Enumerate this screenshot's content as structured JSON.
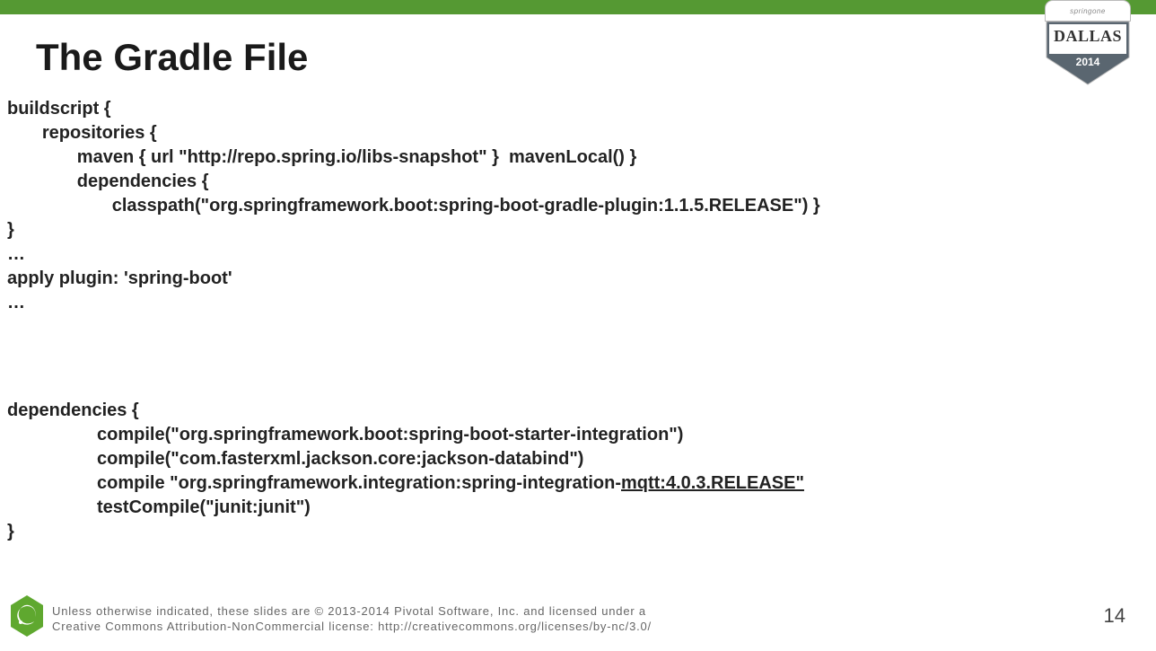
{
  "title": "The Gradle File",
  "badge": {
    "brand": "springone",
    "city": "DALLAS",
    "year": "2014"
  },
  "code_block_1": "buildscript {\n       repositories {\n              maven { url \"http://repo.spring.io/libs-snapshot\" }  mavenLocal() }\n              dependencies {\n                     classpath(\"org.springframework.boot:spring-boot-gradle-plugin:1.1.5.RELEASE\") }\n}\n…\napply plugin: 'spring-boot'\n…",
  "code_block_2_prefix": "dependencies {\n                  compile(\"org.springframework.boot:spring-boot-starter-integration\")\n                  compile(\"com.fasterxml.jackson.core:jackson-databind\")\n                  compile \"org.springframework.integration:spring-integration-",
  "code_block_2_underlined": "mqtt:4.0.3.RELEASE\"",
  "code_block_2_suffix": "\n                  testCompile(\"junit:junit\")\n}",
  "copyright_line1": "Unless otherwise indicated, these slides are © 2013-2014 Pivotal Software, Inc. and licensed under a",
  "copyright_line2": "Creative Commons Attribution-NonCommercial license: http://creativecommons.org/licenses/by-nc/3.0/",
  "page_number": "14"
}
